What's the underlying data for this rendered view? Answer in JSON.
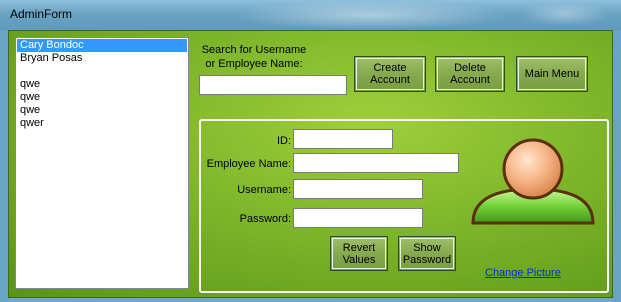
{
  "window": {
    "title": "AdminForm"
  },
  "employee_list": {
    "items": [
      {
        "label": "Cary Bondoc",
        "selected": true
      },
      {
        "label": "Bryan Posas",
        "selected": false
      },
      {
        "label": "",
        "selected": false
      },
      {
        "label": "qwe",
        "selected": false
      },
      {
        "label": "qwe",
        "selected": false
      },
      {
        "label": "qwe",
        "selected": false
      },
      {
        "label": "qwer",
        "selected": false
      }
    ]
  },
  "search": {
    "label_line1": "Search for Username",
    "label_line2": "or Employee Name:",
    "value": ""
  },
  "actions": {
    "create_line1": "Create",
    "create_line2": "Account",
    "delete_line1": "Delete",
    "delete_line2": "Account",
    "main_menu": "Main Menu"
  },
  "details": {
    "id_label": "ID:",
    "id_value": "",
    "employee_name_label": "Employee Name:",
    "employee_name_value": "",
    "username_label": "Username:",
    "username_value": "",
    "password_label": "Password:",
    "password_value": "",
    "revert_line1": "Revert",
    "revert_line2": "Values",
    "show_line1": "Show",
    "show_line2": "Password",
    "change_picture": "Change Picture",
    "avatar_icon": "user-avatar-icon"
  },
  "colors": {
    "background_green": "#7db52a",
    "button_green": "#86aa4e",
    "selection_blue": "#3399ff",
    "link_blue": "#0033cc",
    "avatar_head": "#f0a070",
    "avatar_body": "#7cd640"
  }
}
